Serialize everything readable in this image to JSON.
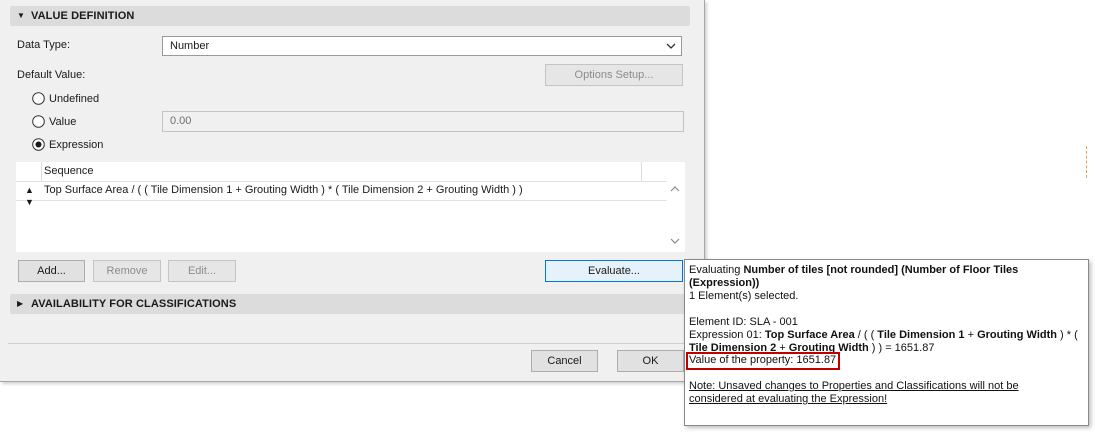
{
  "value_definition": {
    "title": "VALUE DEFINITION",
    "data_type_label": "Data Type:",
    "data_type_value": "Number",
    "default_value_label": "Default Value:",
    "options_setup_label": "Options Setup...",
    "radios": {
      "undefined": "Undefined",
      "value": "Value",
      "expression": "Expression",
      "selected": "expression"
    },
    "value_field": "0.00",
    "table": {
      "column_header": "Sequence",
      "rows": [
        "Top Surface Area / ( ( Tile Dimension 1 + Grouting Width ) * ( Tile Dimension 2 + Grouting Width ) )"
      ]
    },
    "buttons": {
      "add": "Add...",
      "remove": "Remove",
      "edit": "Edit...",
      "evaluate": "Evaluate..."
    }
  },
  "availability": {
    "title": "AVAILABILITY FOR CLASSIFICATIONS"
  },
  "footer": {
    "cancel": "Cancel",
    "ok": "OK"
  },
  "popup": {
    "evaluating_prefix": "Evaluating ",
    "evaluating_name": "Number of tiles [not rounded] (Number of Floor Tiles",
    "evaluating_name_2": "(Expression))",
    "selected_count": "1 Element(s) selected.",
    "element_id": "Element ID: SLA - 001",
    "expr_prefix": "Expression 01: ",
    "expr_part1": "Top Surface Area",
    "expr_sep1": " / ( ( ",
    "expr_part2": "Tile Dimension 1",
    "expr_sep2": " + ",
    "expr_part3": "Grouting Width",
    "expr_sep3": " ) * (",
    "expr_part4": "Tile Dimension 2",
    "expr_sep4": " + ",
    "expr_part5": "Grouting Width",
    "expr_tail": " ) ) = 1651.87",
    "property_value": "Value of the property: 1651.87",
    "note_line1": "Note: Unsaved changes to Properties and Classifications will not be",
    "note_line2": "considered at evaluating the Expression!"
  },
  "colors": {
    "dialog_bg": "#f0f0f0",
    "section_header_bg": "#dcdcdc",
    "focus_border": "#0078d7",
    "highlight_border": "#c00000"
  }
}
